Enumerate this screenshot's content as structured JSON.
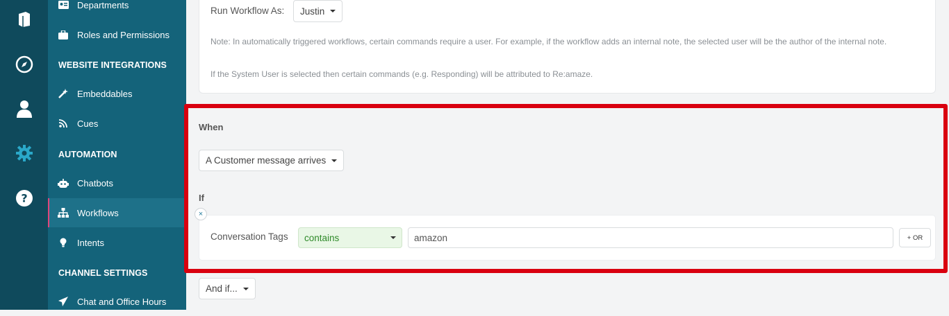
{
  "icon_rail": {
    "icons": [
      "book-icon",
      "compass-icon",
      "user-icon",
      "gear-icon",
      "help-icon"
    ],
    "active_color": "#2aa8c9"
  },
  "sidebar": {
    "items_top": [
      {
        "label": "Departments",
        "icon": "id-card-icon"
      },
      {
        "label": "Roles and Permissions",
        "icon": "briefcase-icon"
      }
    ],
    "section_website": "WEBSITE INTEGRATIONS",
    "items_website": [
      {
        "label": "Embeddables",
        "icon": "magic-wand-icon"
      },
      {
        "label": "Cues",
        "icon": "rss-icon"
      }
    ],
    "section_automation": "AUTOMATION",
    "items_automation": [
      {
        "label": "Chatbots",
        "icon": "robot-icon"
      },
      {
        "label": "Workflows",
        "icon": "sitemap-icon",
        "active": true
      },
      {
        "label": "Intents",
        "icon": "lightbulb-icon"
      }
    ],
    "section_channel": "CHANNEL SETTINGS",
    "items_channel": [
      {
        "label": "Chat and Office Hours",
        "icon": "paper-plane-icon"
      }
    ]
  },
  "run_as": {
    "label": "Run Workflow As:",
    "value": "Justin",
    "note1": "Note: In automatically triggered workflows, certain commands require a user. For example, if the workflow adds an internal note, the selected user will be the author of the internal note.",
    "note2": "If the System User is selected then certain commands (e.g. Responding) will be attributed to Re:amaze."
  },
  "when": {
    "label": "When",
    "trigger": "A Customer message arrives"
  },
  "if": {
    "label": "If",
    "remove": "×",
    "condition_field": "Conversation Tags",
    "operator": "contains",
    "value": "amazon",
    "or_button": "+ OR"
  },
  "and_if": {
    "label": "And if..."
  },
  "colors": {
    "highlight": "#d9000f",
    "sidebar": "#14637a",
    "rail": "#0f4a5c"
  }
}
